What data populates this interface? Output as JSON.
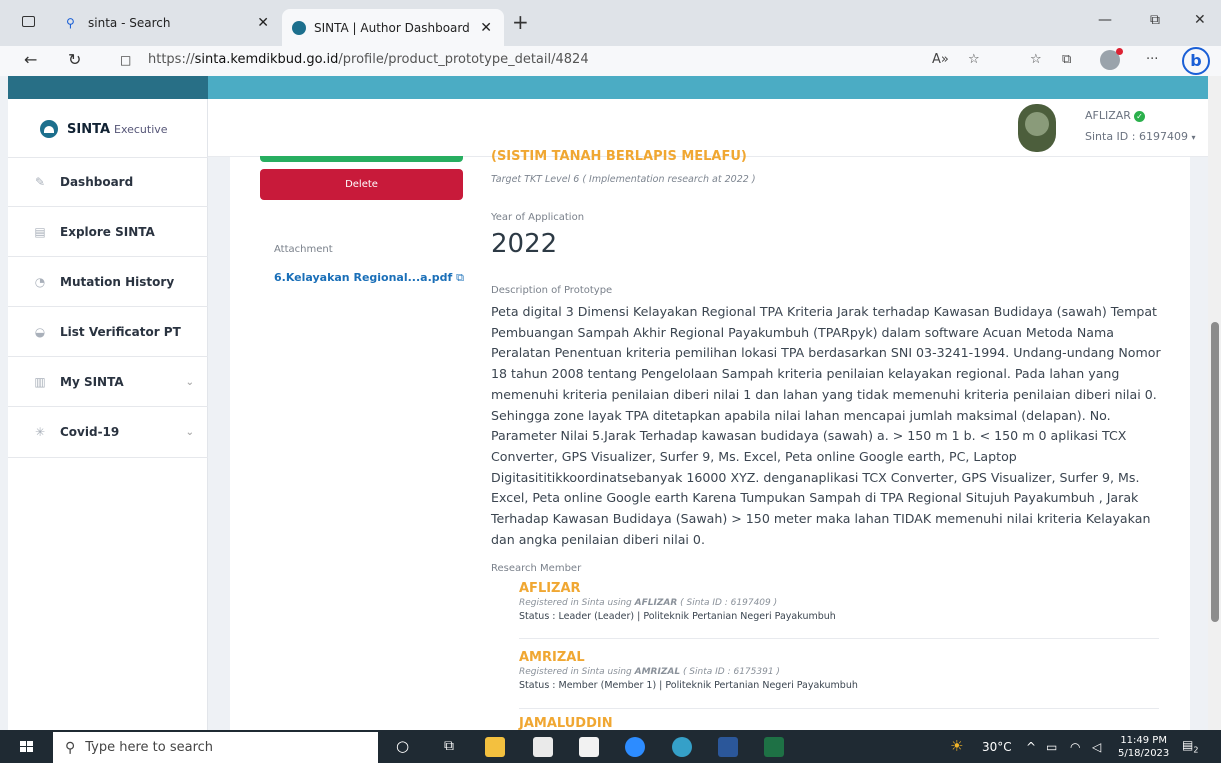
{
  "browser": {
    "tabs": [
      {
        "title": "sinta - Search"
      },
      {
        "title": "SINTA | Author Dashboard"
      }
    ],
    "url_prefix": "https://",
    "url_domain": "sinta.kemdikbud.go.id",
    "url_path": "/profile/product_prototype_detail/4824"
  },
  "sidebar": {
    "logo_bold": "SINTA",
    "logo_small": "Executive",
    "items": [
      {
        "label": "Dashboard"
      },
      {
        "label": "Explore SINTA"
      },
      {
        "label": "Mutation History"
      },
      {
        "label": "List Verificator PT"
      },
      {
        "label": "My SINTA"
      },
      {
        "label": "Covid-19"
      }
    ]
  },
  "user": {
    "name": "AFLIZAR",
    "sinta_id": "Sinta ID : 6197409"
  },
  "actions": {
    "delete_label": "Delete",
    "attachment_label": "Attachment",
    "attachment_file": "6.Kelayakan Regional...a.pdf"
  },
  "prototype": {
    "title_tail": "(SISTIM TANAH BERLAPIS MELAFU)",
    "tkt": "Target TKT Level 6 ( Implementation research at  2022 )",
    "year_label": "Year of Application",
    "year": "2022",
    "desc_label": "Description of Prototype",
    "description": "Peta digital 3 Dimensi Kelayakan Regional TPA Kriteria Jarak terhadap Kawasan Budidaya (sawah) Tempat Pembuangan Sampah Akhir Regional Payakumbuh (TPARpyk) dalam software Acuan Metoda Nama Peralatan Penentuan kriteria pemilihan lokasi TPA berdasarkan SNI 03-3241-1994. Undang-undang Nomor 18 tahun 2008 tentang Pengelolaan Sampah kriteria penilaian kelayakan regional. Pada lahan yang memenuhi kriteria penilaian diberi nilai 1 dan lahan yang tidak memenuhi kriteria penilaian diberi nilai 0. Sehingga zone layak TPA ditetapkan apabila nilai lahan mencapai jumlah maksimal (delapan). No. Parameter Nilai 5.Jarak Terhadap kawasan budidaya (sawah) a. > 150 m 1 b. < 150 m 0 aplikasi TCX Converter, GPS Visualizer, Surfer 9, Ms. Excel, Peta online Google earth, PC, Laptop Digitasititikkoordinatsebanyak 16000 XYZ. denganaplikasi TCX Converter, GPS Visualizer, Surfer 9, Ms. Excel, Peta online Google earth Karena Tumpukan Sampah di TPA Regional Situjuh Payakumbuh , Jarak Terhadap Kawasan Budidaya (Sawah) > 150 meter maka lahan TIDAK memenuhi nilai kriteria Kelayakan dan angka penilaian diberi nilai 0.",
    "members_label": "Research Member",
    "members": [
      {
        "name": "AFLIZAR",
        "reg_prefix": "Registered in Sinta using ",
        "reg_name": "AFLIZAR",
        "reg_suffix": " ( Sinta ID : 6197409 )",
        "status": "Status : Leader (Leader)   |  Politeknik Pertanian Negeri Payakumbuh"
      },
      {
        "name": "AMRIZAL",
        "reg_prefix": "Registered in Sinta using ",
        "reg_name": "AMRIZAL",
        "reg_suffix": " ( Sinta ID : 6175391 )",
        "status": "Status : Member (Member 1)   |  Politeknik Pertanian Negeri Payakumbuh"
      },
      {
        "name": "JAMALUDDIN"
      }
    ]
  },
  "taskbar": {
    "search_placeholder": "Type here to search",
    "weather": "30°C",
    "time": "11:49 PM",
    "date": "5/18/2023",
    "notif_count": "2"
  },
  "colors": {
    "accent_teal": "#4bacc4",
    "delete_red": "#c81a3a",
    "member_orange": "#f0a732",
    "link_blue": "#1a6fb8"
  }
}
